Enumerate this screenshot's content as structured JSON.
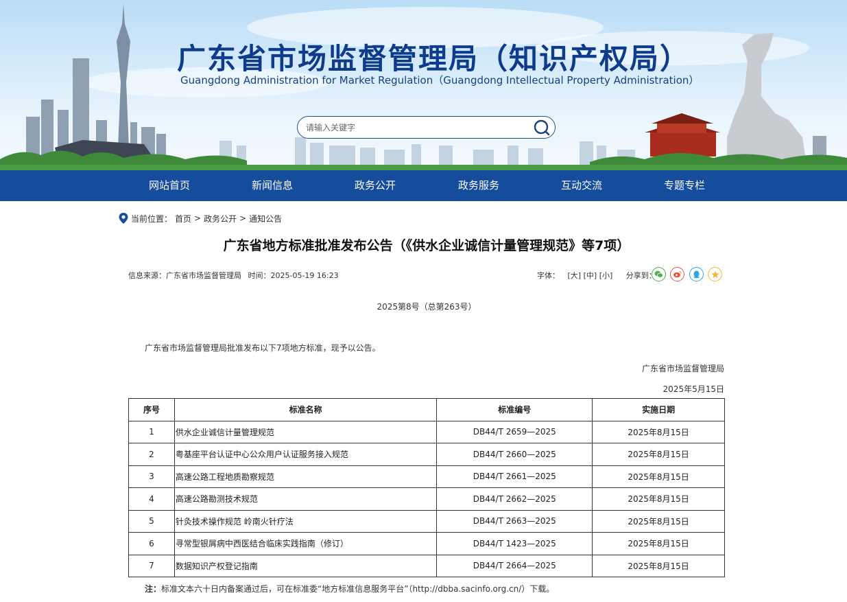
{
  "header": {
    "title": "广东省市场监督管理局（知识产权局）",
    "subtitle": "Guangdong Administration for Market Regulation（Guangdong Intellectual Property Administration）",
    "search_placeholder": "请输入关键字",
    "search_icon": "search-icon"
  },
  "nav": {
    "items": [
      "网站首页",
      "新闻信息",
      "政务公开",
      "政务服务",
      "互动交流",
      "专题专栏"
    ]
  },
  "breadcrumb": {
    "prefix": "当前位置：",
    "items": [
      "首页",
      "政务公开",
      "通知公告"
    ],
    "separator": ">"
  },
  "article": {
    "title": "广东省地方标准批准发布公告（《供水企业诚信计量管理规范》等7项）",
    "source_label": "信息来源：",
    "source": "广东省市场监督管理局",
    "time_label": "时间：",
    "time": "2025-05-19 16:23",
    "font_label": "字体：",
    "font_sizes": [
      "[大]",
      "[中]",
      "[小]"
    ],
    "share_label": "分享到：",
    "share_icons": [
      "wechat-icon",
      "weibo-icon",
      "qq-icon",
      "qzone-icon"
    ],
    "issue": "2025第8号（总第263号）",
    "intro": "广东省市场监督管理局批准发布以下7项地方标准，现予以公告。",
    "signer": "广东省市场监督管理局",
    "sign_date": "2025年5月15日",
    "table": {
      "headers": [
        "序号",
        "标准名称",
        "标准编号",
        "实施日期"
      ],
      "rows": [
        [
          "1",
          "供水企业诚信计量管理规范",
          "DB44/T 2659—2025",
          "2025年8月15日"
        ],
        [
          "2",
          "粤基座平台认证中心公众用户认证服务接入规范",
          "DB44/T 2660—2025",
          "2025年8月15日"
        ],
        [
          "3",
          "高速公路工程地质勘察规范",
          "DB44/T 2661—2025",
          "2025年8月15日"
        ],
        [
          "4",
          "高速公路勘测技术规范",
          "DB44/T 2662—2025",
          "2025年8月15日"
        ],
        [
          "5",
          "针灸技术操作规范 岭南火针疗法",
          "DB44/T 2663—2025",
          "2025年8月15日"
        ],
        [
          "6",
          "寻常型银屑病中西医结合临床实践指南（修订）",
          "DB44/T 1423—2025",
          "2025年8月15日"
        ],
        [
          "7",
          "数据知识产权登记指南",
          "DB44/T 2664—2025",
          "2025年8月15日"
        ]
      ]
    },
    "note_label": "注：",
    "note_text": "标准文本六十日内备案通过后，可在标准委“地方标准信息服务平台”（http://dbba.sacinfo.org.cn/）下载。"
  },
  "colors": {
    "nav_bg": "#164c9c",
    "title_blue": "#0e3b8a"
  }
}
